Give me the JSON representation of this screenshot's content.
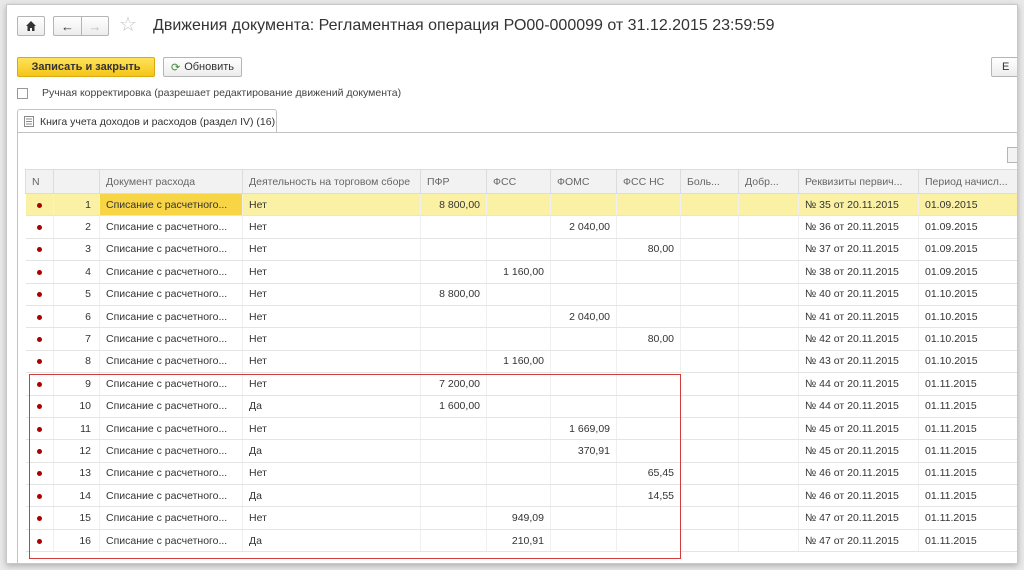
{
  "window": {
    "title": "Движения документа: Регламентная операция РО00-000099 от 31.12.2015 23:59:59"
  },
  "toolbar": {
    "save_close": "Записать и закрыть",
    "refresh": "Обновить",
    "more": "Е"
  },
  "manual_edit": {
    "label": "Ручная корректировка (разрешает редактирование движений документа)",
    "checked": false
  },
  "tab": {
    "label": "Книга учета доходов и расходов (раздел IV) (16)"
  },
  "grid": {
    "columns": [
      "N",
      "Документ расхода",
      "Деятельность на торговом сборе",
      "ПФР",
      "ФСС",
      "ФОМС",
      "ФСС НС",
      "Боль...",
      "Добр...",
      "Реквизиты первич...",
      "Период начисл..."
    ],
    "selected_row": 0,
    "rows": [
      {
        "n": "1",
        "doc": "Списание с расчетного...",
        "activity": "Нет",
        "pfr": "8 800,00",
        "fss": "",
        "foms": "",
        "fssns": "",
        "bol": "",
        "dobr": "",
        "rekv": "№ 35 от 20.11.2015",
        "period": "01.09.2015"
      },
      {
        "n": "2",
        "doc": "Списание с расчетного...",
        "activity": "Нет",
        "pfr": "",
        "fss": "",
        "foms": "2 040,00",
        "fssns": "",
        "bol": "",
        "dobr": "",
        "rekv": "№ 36 от 20.11.2015",
        "period": "01.09.2015"
      },
      {
        "n": "3",
        "doc": "Списание с расчетного...",
        "activity": "Нет",
        "pfr": "",
        "fss": "",
        "foms": "",
        "fssns": "80,00",
        "bol": "",
        "dobr": "",
        "rekv": "№ 37 от 20.11.2015",
        "period": "01.09.2015"
      },
      {
        "n": "4",
        "doc": "Списание с расчетного...",
        "activity": "Нет",
        "pfr": "",
        "fss": "1 160,00",
        "foms": "",
        "fssns": "",
        "bol": "",
        "dobr": "",
        "rekv": "№ 38 от 20.11.2015",
        "period": "01.09.2015"
      },
      {
        "n": "5",
        "doc": "Списание с расчетного...",
        "activity": "Нет",
        "pfr": "8 800,00",
        "fss": "",
        "foms": "",
        "fssns": "",
        "bol": "",
        "dobr": "",
        "rekv": "№ 40 от 20.11.2015",
        "period": "01.10.2015"
      },
      {
        "n": "6",
        "doc": "Списание с расчетного...",
        "activity": "Нет",
        "pfr": "",
        "fss": "",
        "foms": "2 040,00",
        "fssns": "",
        "bol": "",
        "dobr": "",
        "rekv": "№ 41 от 20.11.2015",
        "period": "01.10.2015"
      },
      {
        "n": "7",
        "doc": "Списание с расчетного...",
        "activity": "Нет",
        "pfr": "",
        "fss": "",
        "foms": "",
        "fssns": "80,00",
        "bol": "",
        "dobr": "",
        "rekv": "№ 42 от 20.11.2015",
        "period": "01.10.2015"
      },
      {
        "n": "8",
        "doc": "Списание с расчетного...",
        "activity": "Нет",
        "pfr": "",
        "fss": "1 160,00",
        "foms": "",
        "fssns": "",
        "bol": "",
        "dobr": "",
        "rekv": "№ 43 от 20.11.2015",
        "period": "01.10.2015"
      },
      {
        "n": "9",
        "doc": "Списание с расчетного...",
        "activity": "Нет",
        "pfr": "7 200,00",
        "fss": "",
        "foms": "",
        "fssns": "",
        "bol": "",
        "dobr": "",
        "rekv": "№ 44 от 20.11.2015",
        "period": "01.11.2015"
      },
      {
        "n": "10",
        "doc": "Списание с расчетного...",
        "activity": "Да",
        "pfr": "1 600,00",
        "fss": "",
        "foms": "",
        "fssns": "",
        "bol": "",
        "dobr": "",
        "rekv": "№ 44 от 20.11.2015",
        "period": "01.11.2015"
      },
      {
        "n": "11",
        "doc": "Списание с расчетного...",
        "activity": "Нет",
        "pfr": "",
        "fss": "",
        "foms": "1 669,09",
        "fssns": "",
        "bol": "",
        "dobr": "",
        "rekv": "№ 45 от 20.11.2015",
        "period": "01.11.2015"
      },
      {
        "n": "12",
        "doc": "Списание с расчетного...",
        "activity": "Да",
        "pfr": "",
        "fss": "",
        "foms": "370,91",
        "fssns": "",
        "bol": "",
        "dobr": "",
        "rekv": "№ 45 от 20.11.2015",
        "period": "01.11.2015"
      },
      {
        "n": "13",
        "doc": "Списание с расчетного...",
        "activity": "Нет",
        "pfr": "",
        "fss": "",
        "foms": "",
        "fssns": "65,45",
        "bol": "",
        "dobr": "",
        "rekv": "№ 46 от 20.11.2015",
        "period": "01.11.2015"
      },
      {
        "n": "14",
        "doc": "Списание с расчетного...",
        "activity": "Да",
        "pfr": "",
        "fss": "",
        "foms": "",
        "fssns": "14,55",
        "bol": "",
        "dobr": "",
        "rekv": "№ 46 от 20.11.2015",
        "period": "01.11.2015"
      },
      {
        "n": "15",
        "doc": "Списание с расчетного...",
        "activity": "Нет",
        "pfr": "",
        "fss": "949,09",
        "foms": "",
        "fssns": "",
        "bol": "",
        "dobr": "",
        "rekv": "№ 47 от 20.11.2015",
        "period": "01.11.2015"
      },
      {
        "n": "16",
        "doc": "Списание с расчетного...",
        "activity": "Да",
        "pfr": "",
        "fss": "210,91",
        "foms": "",
        "fssns": "",
        "bol": "",
        "dobr": "",
        "rekv": "№ 47 от 20.11.2015",
        "period": "01.11.2015"
      }
    ]
  },
  "colors": {
    "selected_row": "#fbf1a5",
    "selected_cell": "#f7d545",
    "primary_button": "#f5c519",
    "highlight_box": "#d23b3b",
    "row_marker": "#aa0000"
  }
}
